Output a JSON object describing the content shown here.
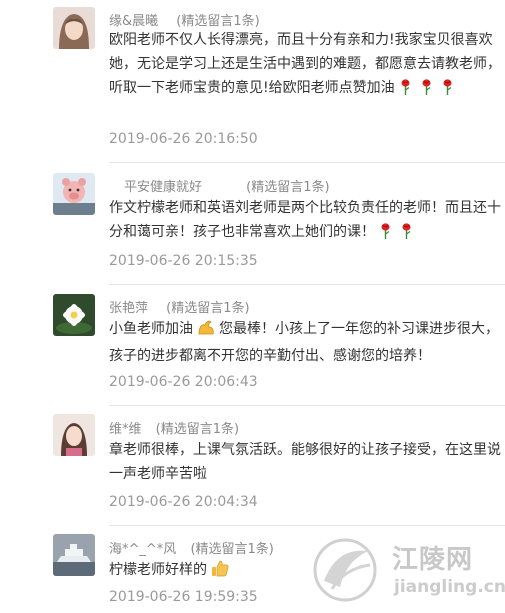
{
  "comments": [
    {
      "name": "缘&晨曦",
      "tag": "(精选留言1条)",
      "text": "欧阳老师不仅人长得漂亮，而且十分有亲和力!我家宝贝很喜欢她，无论是学习上还是生活中遇到的难题，都愿意去请教老师，听取一下老师宝贵的意见!给欧阳老师点赞加油",
      "time": "2019-06-26 20:16:50"
    },
    {
      "name": "平安健康就好",
      "tag": "(精选留言1条)",
      "text": "作文柠檬老师和英语刘老师是两个比较负责任的老师！而且还十分和蔼可亲！孩子也非常喜欢上她们的课！",
      "time": "2019-06-26 20:15:35"
    },
    {
      "name": "张艳萍",
      "tag": "(精选留言1条)",
      "text_a": "小鱼老师加油",
      "text_b": "您最棒！小孩上了一年您的补习课进步很大，孩子的进步都离不开您的辛勤付出、感谢您的培养！",
      "time": "2019-06-26 20:06:43"
    },
    {
      "name": "维*维",
      "tag": "(精选留言1条)",
      "text": "章老师很棒，上课气氛活跃。能够很好的让孩子接受，在这里说一声老师辛苦啦",
      "time": "2019-06-26 20:04:34"
    },
    {
      "name": "海*^_^*风",
      "tag": "(精选留言1条)",
      "text": "柠檬老师好样的",
      "time": "2019-06-26 19:59:35"
    }
  ],
  "icons": {
    "rose": "rose-icon",
    "flexed_biceps": "flexed-biceps-icon",
    "thumbs_up": "thumbs-up-icon"
  },
  "watermark": {
    "title": "江陵网",
    "url": "jiangling.cn",
    "color": "#c8c8c8"
  }
}
